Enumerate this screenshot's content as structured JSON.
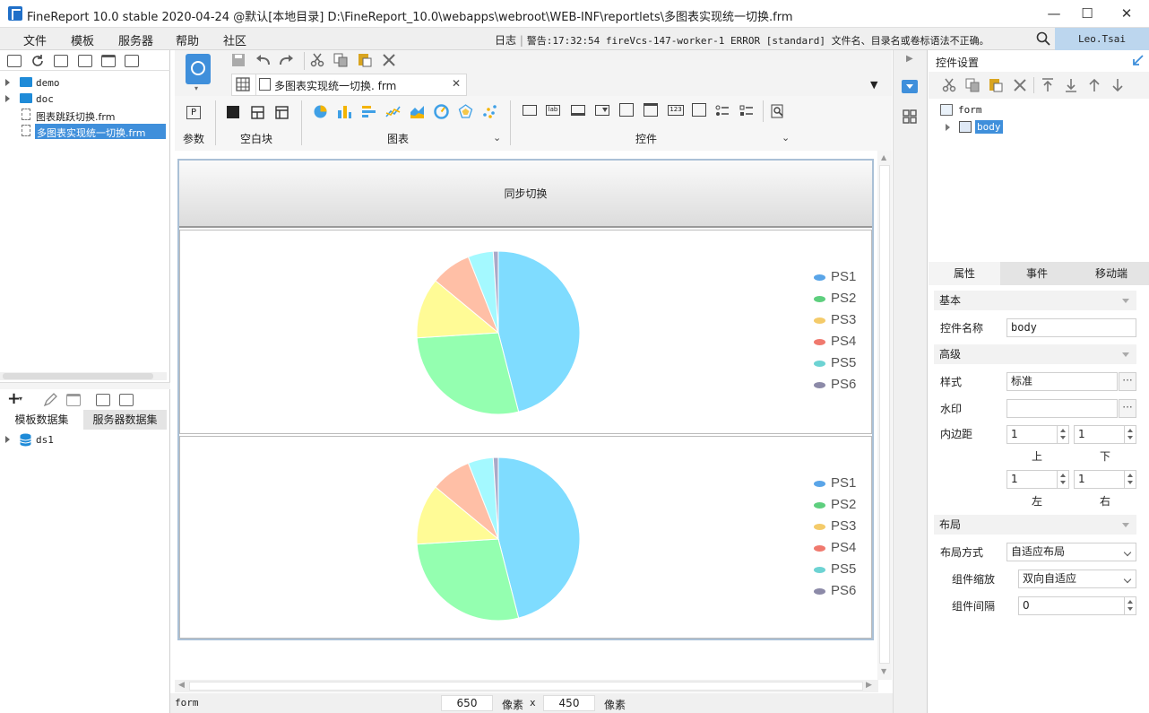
{
  "window": {
    "title": "FineReport 10.0 stable 2020-04-24 @默认[本地目录]    D:\\FineReport_10.0\\webapps\\webroot\\WEB-INF\\reportlets\\多图表实现统一切换.frm",
    "minimize": "—",
    "maximize": "☐",
    "close": "✕"
  },
  "menu": {
    "items": [
      "文件",
      "模板",
      "服务器",
      "帮助",
      "社区"
    ],
    "log_label": "日志",
    "log_text": "警告:17:32:54 fireVcs-147-worker-1 ERROR [standard] 文件名、目录名或卷标语法不正确。",
    "user": "Leo.Tsai"
  },
  "tree": {
    "items": [
      {
        "label": "demo",
        "type": "folder"
      },
      {
        "label": "doc",
        "type": "folder"
      },
      {
        "label": "图表跳跃切换.frm",
        "type": "file"
      },
      {
        "label": "多图表实现统一切换.frm",
        "type": "file",
        "selected": true
      }
    ]
  },
  "datasets": {
    "tabs": [
      "模板数据集",
      "服务器数据集"
    ],
    "items": [
      "ds1"
    ]
  },
  "editor": {
    "tab_title": "多图表实现统一切换. frm",
    "groups": [
      "参数",
      "空白块",
      "图表",
      "控件"
    ]
  },
  "canvas": {
    "button_label": "同步切换",
    "status_left": "form",
    "width": "650",
    "height": "450",
    "unit1": "像素",
    "times": "x",
    "unit2": "像素"
  },
  "chart_data": [
    {
      "type": "pie",
      "labels": [
        "PS1",
        "PS2",
        "PS3",
        "PS4",
        "PS5",
        "PS6"
      ],
      "values": [
        46,
        28,
        12,
        8,
        5,
        1
      ],
      "colors": [
        "#7fdcff",
        "#94ffb0",
        "#fffb96",
        "#ffbfa6",
        "#a4f9ff",
        "#a9a9c8"
      ],
      "legend_colors": [
        "#5aa5e8",
        "#5ecf7e",
        "#f4cb6a",
        "#f0796e",
        "#6dd3d3",
        "#8c8aa8"
      ],
      "legend": "right"
    },
    {
      "type": "pie",
      "labels": [
        "PS1",
        "PS2",
        "PS3",
        "PS4",
        "PS5",
        "PS6"
      ],
      "values": [
        46,
        28,
        12,
        8,
        5,
        1
      ],
      "colors": [
        "#7fdcff",
        "#94ffb0",
        "#fffb96",
        "#ffbfa6",
        "#a4f9ff",
        "#a9a9c8"
      ],
      "legend_colors": [
        "#5aa5e8",
        "#5ecf7e",
        "#f4cb6a",
        "#f0796e",
        "#6dd3d3",
        "#8c8aa8"
      ],
      "legend": "right"
    }
  ],
  "right_panel": {
    "title": "控件设置",
    "tree_root": "form",
    "tree_child": "body",
    "tabs": [
      "属性",
      "事件",
      "移动端"
    ],
    "sections": {
      "basic": "基本",
      "advanced": "高级",
      "layout": "布局"
    },
    "fields": {
      "name_label": "控件名称",
      "name_value": "body",
      "style_label": "样式",
      "style_value": "标准",
      "watermark_label": "水印",
      "watermark_value": "",
      "padding_label": "内边距",
      "padding_top": "1",
      "padding_bottom": "1",
      "padding_left": "1",
      "padding_right": "1",
      "top_label": "上",
      "bottom_label": "下",
      "left_label": "左",
      "right_label": "右",
      "layout_mode_label": "布局方式",
      "layout_mode_value": "自适应布局",
      "scale_label": "组件缩放",
      "scale_value": "双向自适应",
      "gap_label": "组件间隔",
      "gap_value": "0"
    },
    "dots": "···"
  }
}
